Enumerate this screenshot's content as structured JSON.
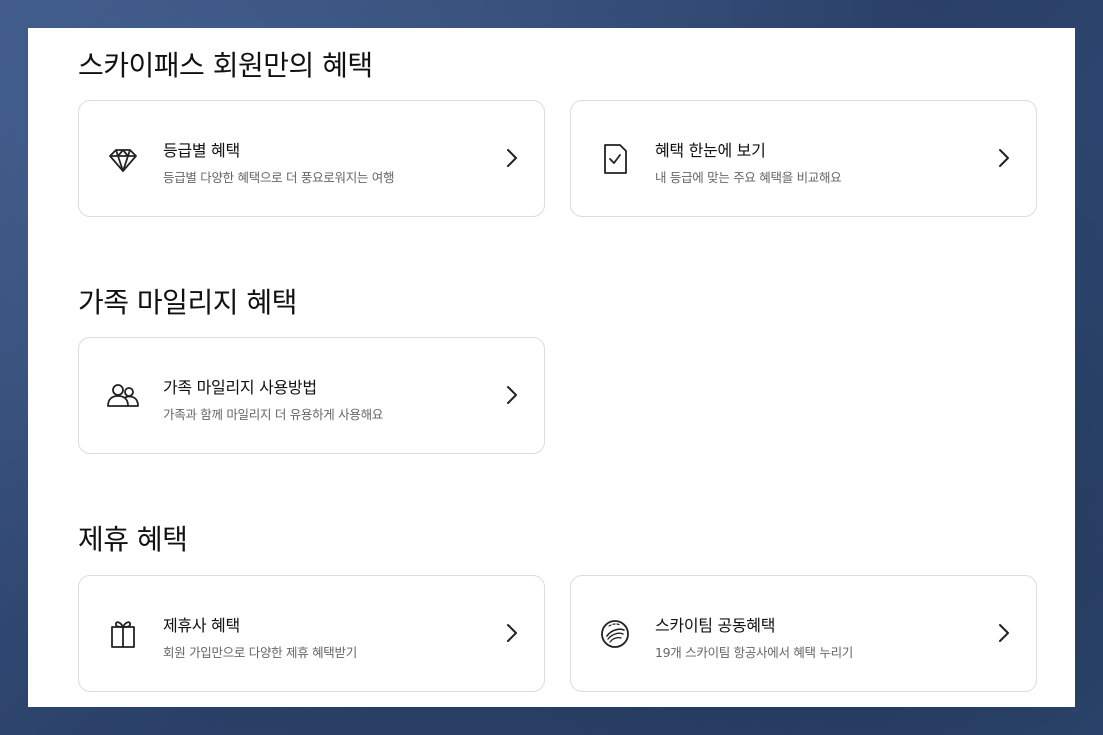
{
  "sections": [
    {
      "title": "스카이패스 회원만의 혜택",
      "cards": [
        {
          "icon": "diamond-icon",
          "title": "등급별 혜택",
          "desc": "등급별 다양한 혜택으로 더 풍요로워지는 여행"
        },
        {
          "icon": "checklist-doc-icon",
          "title": "혜택 한눈에 보기",
          "desc": "내 등급에 맞는 주요 혜택을 비교해요"
        }
      ]
    },
    {
      "title": "가족 마일리지 혜택",
      "cards": [
        {
          "icon": "family-icon",
          "title": "가족 마일리지 사용방법",
          "desc": "가족과 함께 마일리지 더 유용하게 사용해요"
        }
      ]
    },
    {
      "title": "제휴 혜택",
      "cards": [
        {
          "icon": "gift-icon",
          "title": "제휴사 혜택",
          "desc": "회원 가입만으로 다양한 제휴 혜택받기"
        },
        {
          "icon": "skyteam-icon",
          "title": "스카이팀 공동혜택",
          "desc": "19개 스카이팀 항공사에서 혜택 누리기"
        }
      ]
    }
  ]
}
